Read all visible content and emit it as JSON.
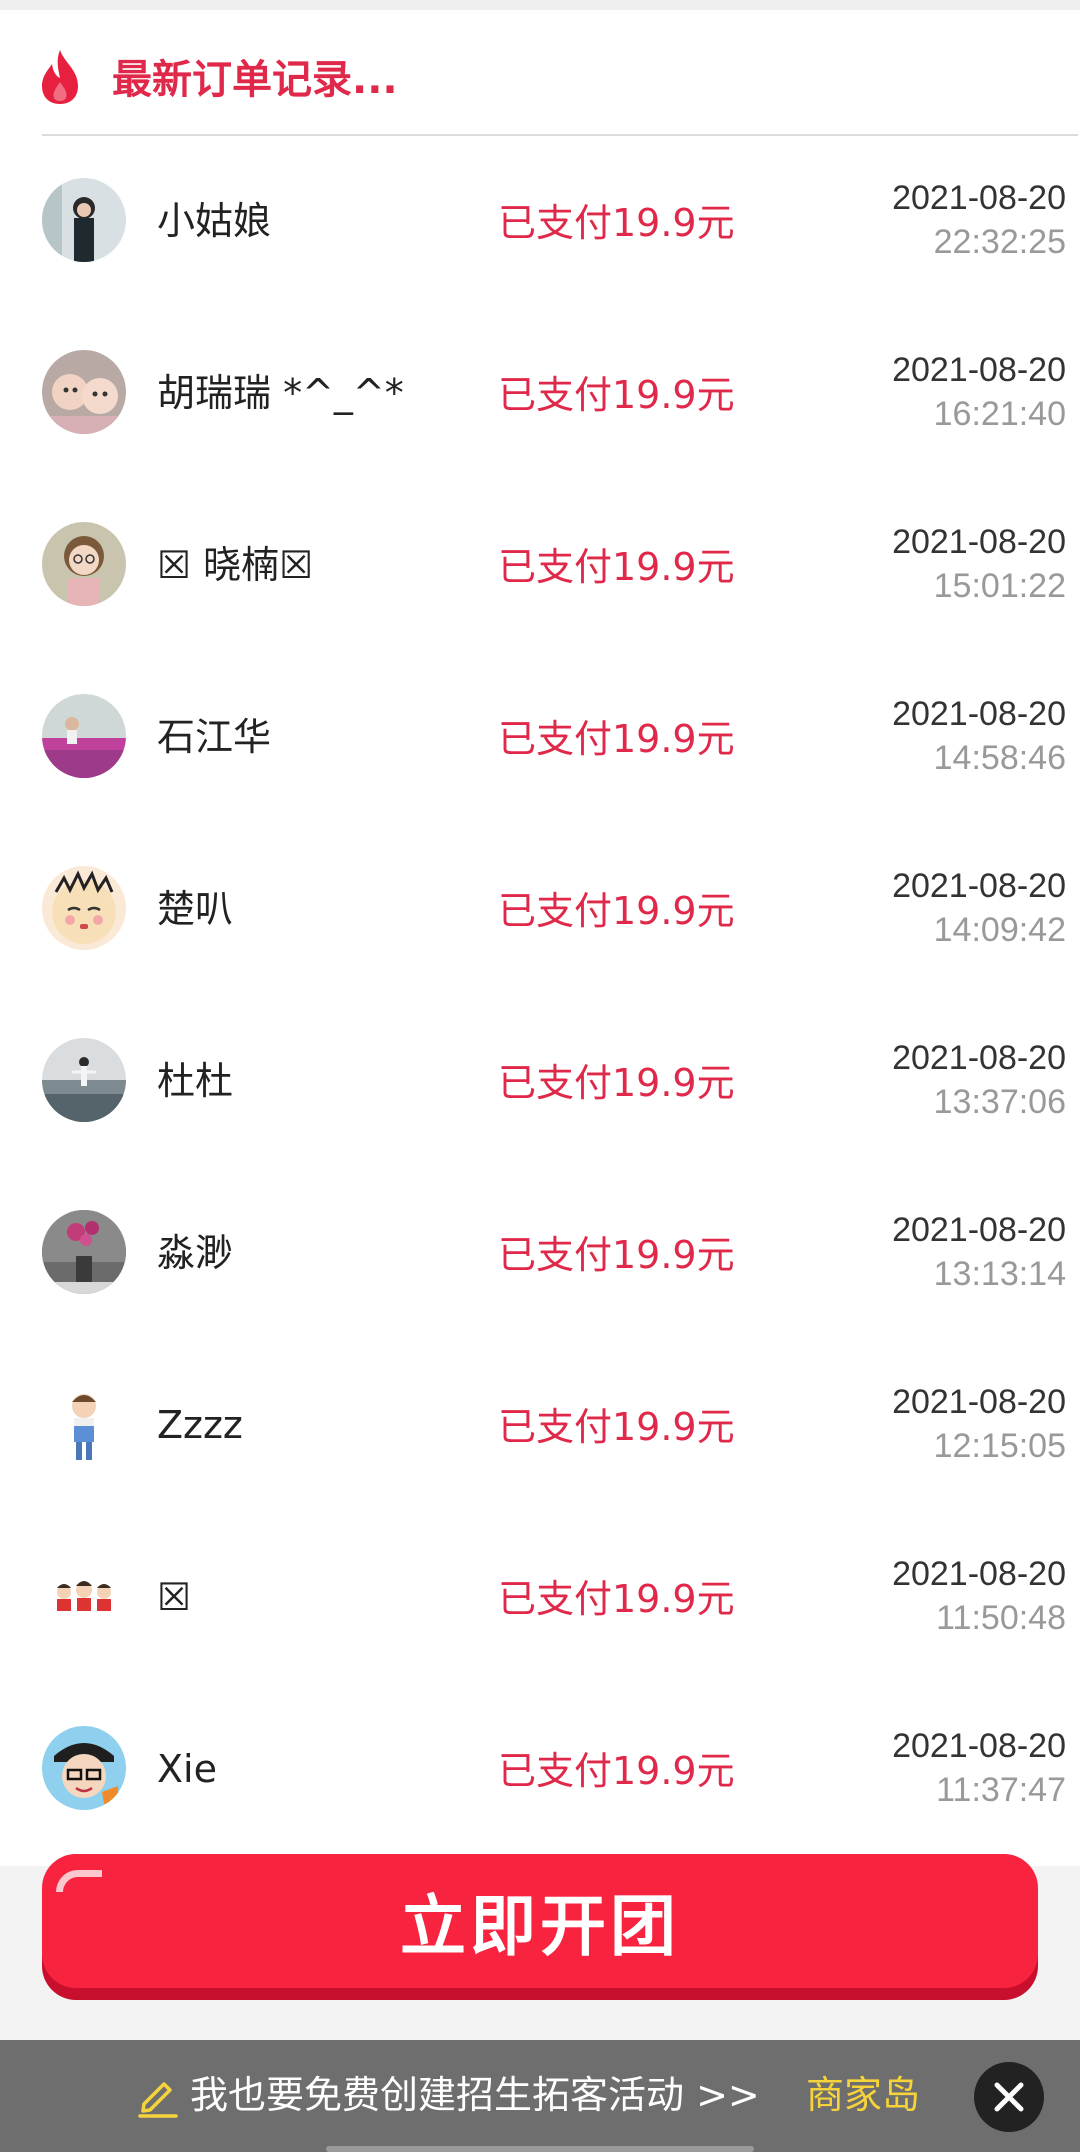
{
  "header": {
    "title": "最新订单记录..."
  },
  "orders": [
    {
      "name": "小姑娘",
      "status": "已支付19.9元",
      "date": "2021-08-20",
      "time": "22:32:25"
    },
    {
      "name": "胡瑞瑞 *^_^*",
      "status": "已支付19.9元",
      "date": "2021-08-20",
      "time": "16:21:40"
    },
    {
      "name": "☒ 晓楠☒",
      "status": "已支付19.9元",
      "date": "2021-08-20",
      "time": "15:01:22"
    },
    {
      "name": "石江华",
      "status": "已支付19.9元",
      "date": "2021-08-20",
      "time": "14:58:46"
    },
    {
      "name": "楚叭",
      "status": "已支付19.9元",
      "date": "2021-08-20",
      "time": "14:09:42"
    },
    {
      "name": "杜杜",
      "status": "已支付19.9元",
      "date": "2021-08-20",
      "time": "13:37:06"
    },
    {
      "name": "淼渺",
      "status": "已支付19.9元",
      "date": "2021-08-20",
      "time": "13:13:14"
    },
    {
      "name": "Zzzz",
      "status": "已支付19.9元",
      "date": "2021-08-20",
      "time": "12:15:05"
    },
    {
      "name": "☒",
      "status": "已支付19.9元",
      "date": "2021-08-20",
      "time": "11:50:48"
    },
    {
      "name": "Xie",
      "status": "已支付19.9元",
      "date": "2021-08-20",
      "time": "11:37:47"
    }
  ],
  "cta": {
    "label": "立即开团"
  },
  "footer": {
    "text": "我也要免费创建招生拓客活动 >>",
    "link": "商家岛"
  },
  "icons": {
    "header": "flame-icon",
    "footer": "pencil-icon",
    "close": "close-icon"
  },
  "colors": {
    "accent": "#e0294a",
    "cta": "#f7233f",
    "link": "#f6d33a",
    "footer_bg": "#6e6e6e"
  }
}
